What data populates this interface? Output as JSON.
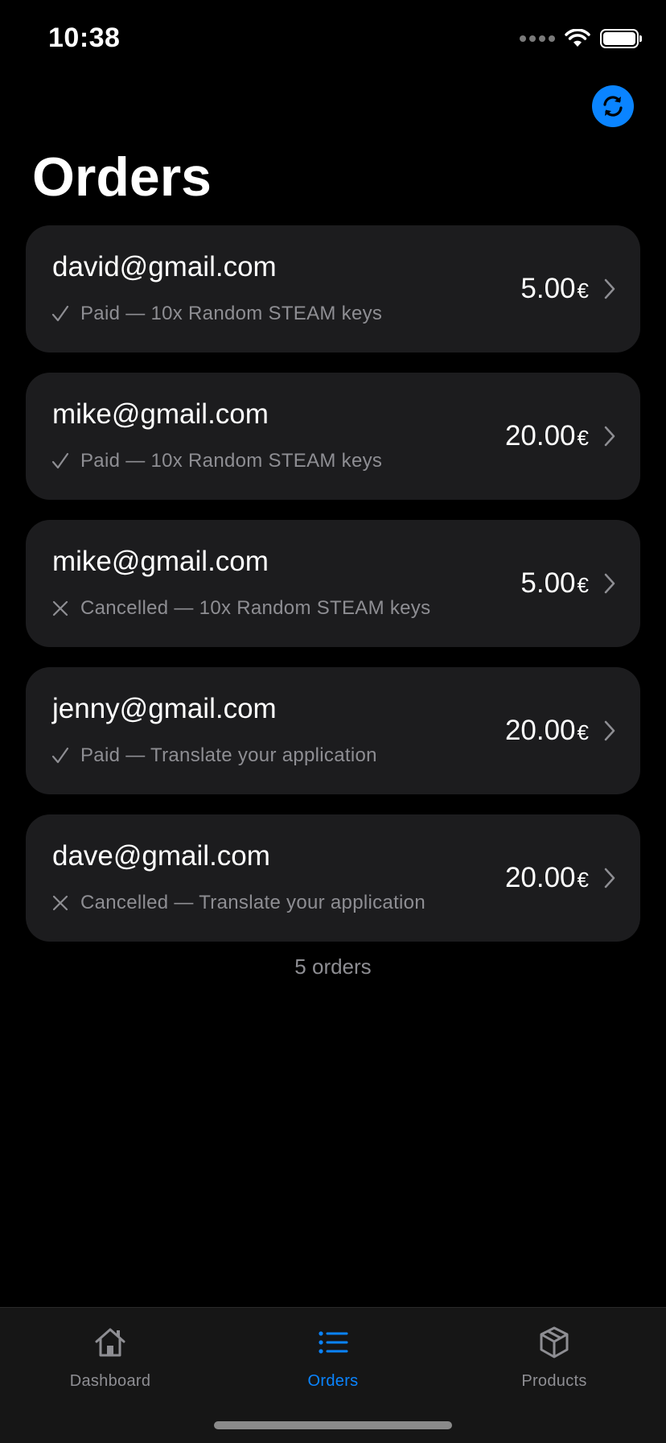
{
  "status_bar": {
    "time": "10:38"
  },
  "header": {
    "title": "Orders",
    "refresh_icon": "refresh-icon"
  },
  "orders": [
    {
      "email": "david@gmail.com",
      "status_icon": "check-icon",
      "status": "Paid — 10x Random STEAM keys",
      "amount": "5.00",
      "currency": "€"
    },
    {
      "email": "mike@gmail.com",
      "status_icon": "check-icon",
      "status": "Paid — 10x Random STEAM keys",
      "amount": "20.00",
      "currency": "€"
    },
    {
      "email": "mike@gmail.com",
      "status_icon": "x-icon",
      "status": "Cancelled — 10x Random STEAM keys",
      "amount": "5.00",
      "currency": "€"
    },
    {
      "email": "jenny@gmail.com",
      "status_icon": "check-icon",
      "status": "Paid — Translate your application",
      "amount": "20.00",
      "currency": "€"
    },
    {
      "email": "dave@gmail.com",
      "status_icon": "x-icon",
      "status": "Cancelled — Translate your application",
      "amount": "20.00",
      "currency": "€"
    }
  ],
  "orders_count": "5 orders",
  "tab_bar": {
    "tabs": [
      {
        "label": "Dashboard",
        "icon": "house-icon",
        "active": false
      },
      {
        "label": "Orders",
        "icon": "list-icon",
        "active": true
      },
      {
        "label": "Products",
        "icon": "box-icon",
        "active": false
      }
    ]
  },
  "colors": {
    "accent": "#0a84ff",
    "background": "#000000",
    "card": "#1c1c1e",
    "secondary_text": "#8e8e93"
  }
}
